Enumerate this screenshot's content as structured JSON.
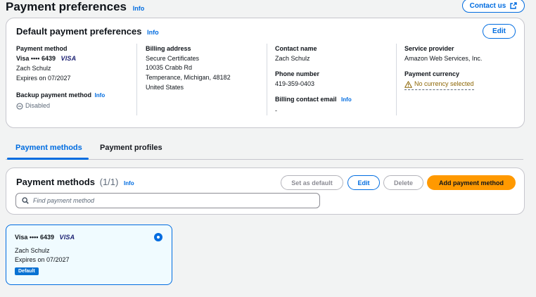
{
  "header": {
    "title": "Payment preferences",
    "info": "Info",
    "contact_label": "Contact us"
  },
  "defaults": {
    "title": "Default payment preferences",
    "info": "Info",
    "edit_label": "Edit",
    "payment_method": {
      "label": "Payment method",
      "card_number": "Visa •••• 6439",
      "brand": "VISA",
      "holder": "Zach Schulz",
      "expires": "Expires on 07/2027"
    },
    "backup": {
      "label": "Backup payment method",
      "info": "Info",
      "status": "Disabled"
    },
    "billing": {
      "label": "Billing address",
      "lines": [
        "Secure Certificates",
        "10035 Crabb Rd",
        "Temperance, Michigan, 48182",
        "United States"
      ]
    },
    "contact": {
      "label": "Contact name",
      "value": "Zach Schulz"
    },
    "phone": {
      "label": "Phone number",
      "value": "419-359-0403"
    },
    "billing_email": {
      "label": "Billing contact email",
      "info": "Info",
      "value": "-"
    },
    "provider": {
      "label": "Service provider",
      "value": "Amazon Web Services, Inc."
    },
    "currency": {
      "label": "Payment currency",
      "value": "No currency selected"
    }
  },
  "tabs": [
    {
      "label": "Payment methods"
    },
    {
      "label": "Payment profiles"
    }
  ],
  "methods": {
    "title": "Payment methods",
    "count": "(1/1)",
    "info": "Info",
    "set_default_label": "Set as default",
    "edit_label": "Edit",
    "delete_label": "Delete",
    "add_label": "Add payment method",
    "search_placeholder": "Find payment method"
  },
  "card_item": {
    "card_number": "Visa •••• 6439",
    "brand": "VISA",
    "holder": "Zach Schulz",
    "expires": "Expires on 07/2027",
    "badge": "Default",
    "selected": true
  },
  "colors": {
    "accent": "#006ce0",
    "primary_button": "#ff9900",
    "warning": "#8d6605",
    "selected_card_bg": "#f0fbff"
  }
}
